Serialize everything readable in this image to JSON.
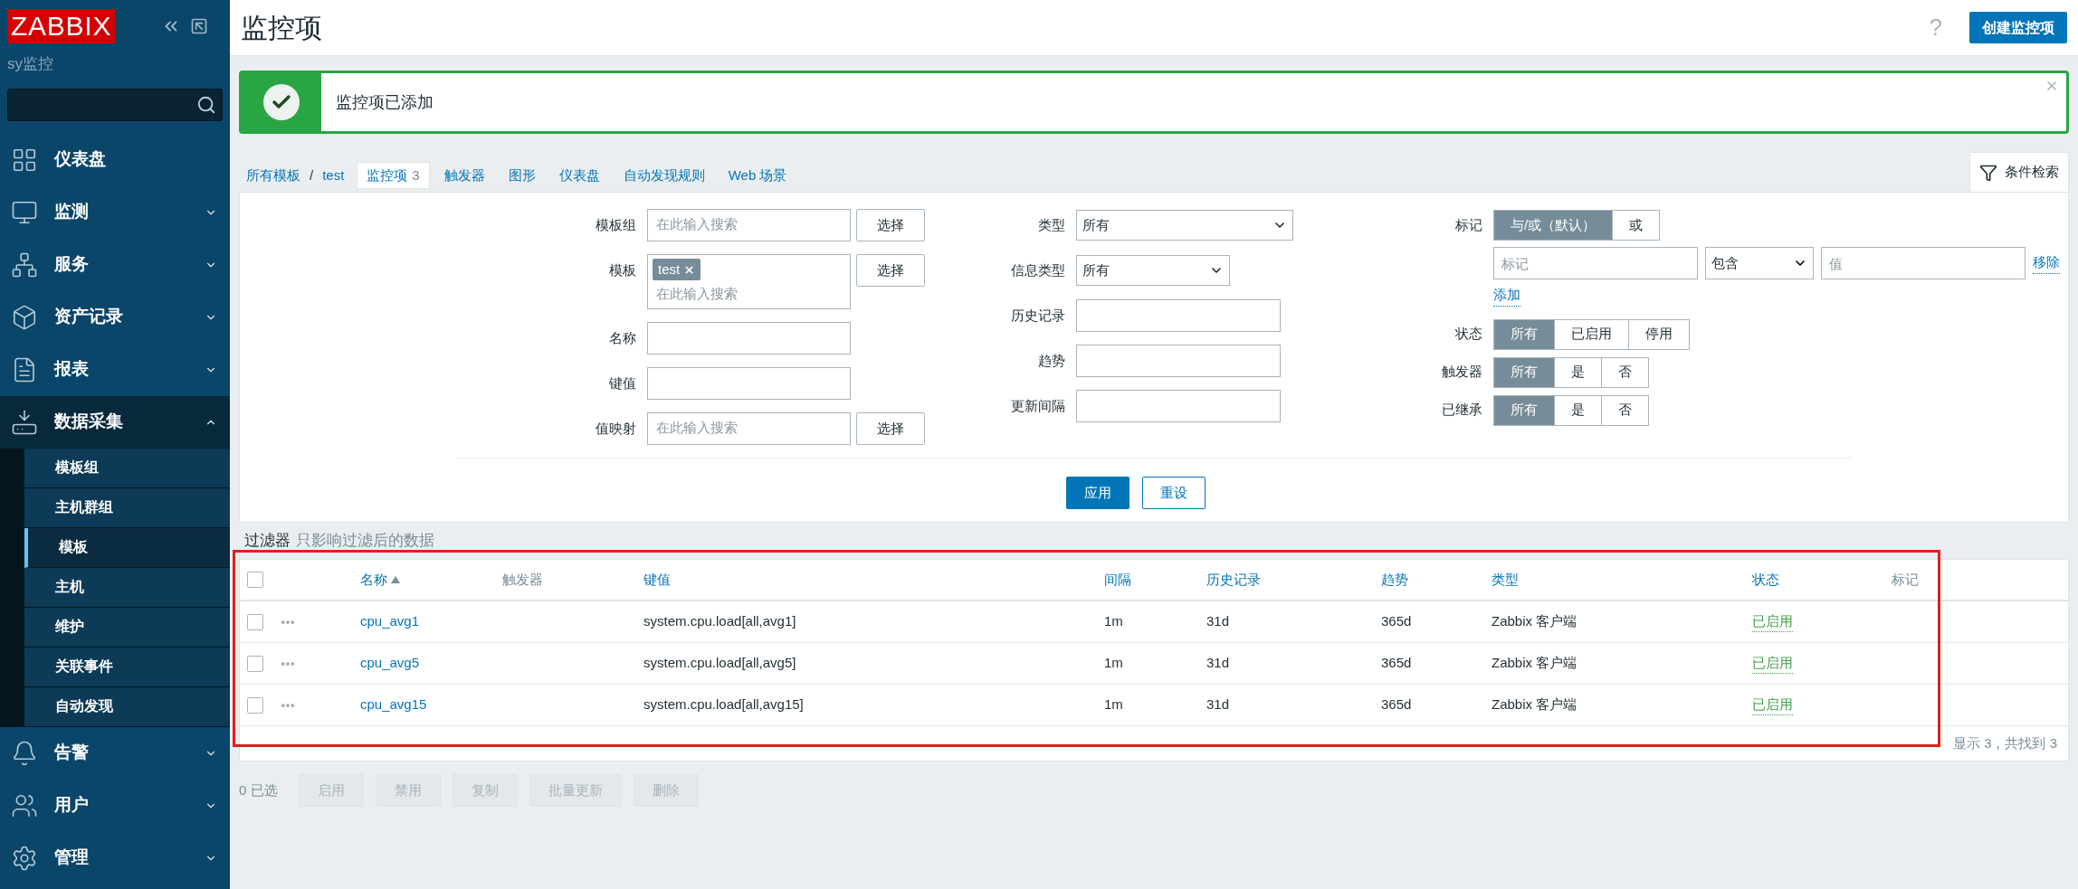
{
  "sidebar": {
    "logo": "ZABBIX",
    "instance": "sy监控",
    "menu": [
      {
        "label": "仪表盘",
        "kind": "dashboard",
        "expanded": false,
        "has_submenu": false
      },
      {
        "label": "监测",
        "kind": "monitoring",
        "expanded": false,
        "has_submenu": true
      },
      {
        "label": "服务",
        "kind": "services",
        "expanded": false,
        "has_submenu": true
      },
      {
        "label": "资产记录",
        "kind": "inventory",
        "expanded": false,
        "has_submenu": true
      },
      {
        "label": "报表",
        "kind": "reports",
        "expanded": false,
        "has_submenu": true
      },
      {
        "label": "数据采集",
        "kind": "datacollection",
        "expanded": true,
        "has_submenu": true,
        "children": [
          {
            "label": "模板组",
            "selected": false
          },
          {
            "label": "主机群组",
            "selected": false
          },
          {
            "label": "模板",
            "selected": true
          },
          {
            "label": "主机",
            "selected": false
          },
          {
            "label": "维护",
            "selected": false
          },
          {
            "label": "关联事件",
            "selected": false
          },
          {
            "label": "自动发现",
            "selected": false
          }
        ]
      },
      {
        "label": "告警",
        "kind": "alerts",
        "expanded": false,
        "has_submenu": true
      },
      {
        "label": "用户",
        "kind": "users",
        "expanded": false,
        "has_submenu": true
      },
      {
        "label": "管理",
        "kind": "admin",
        "expanded": false,
        "has_submenu": true
      }
    ]
  },
  "header": {
    "title": "监控项",
    "help": "?",
    "create_button": "创建监控项"
  },
  "message": {
    "kind": "success",
    "text": "监控项已添加"
  },
  "breadcrumbs": [
    {
      "label": "所有模板"
    },
    {
      "label": "test"
    }
  ],
  "breadcrumb_separator": "/",
  "nav_tabs": [
    {
      "label": "监控项",
      "count": "3",
      "selected": true
    },
    {
      "label": "触发器",
      "selected": false
    },
    {
      "label": "图形",
      "selected": false
    },
    {
      "label": "仪表盘",
      "selected": false
    },
    {
      "label": "自动发现规则",
      "selected": false
    },
    {
      "label": "Web 场景",
      "selected": false
    }
  ],
  "filter": {
    "tab_label": "条件检索",
    "expanded": true,
    "left": [
      {
        "kind": "multiselect",
        "label": "模板组",
        "placeholder": "在此输入搜索",
        "button": "选择"
      },
      {
        "kind": "multiselect",
        "label": "模板",
        "chips": [
          "test"
        ],
        "placeholder": "在此输入搜索",
        "button": "选择"
      },
      {
        "kind": "text",
        "label": "名称"
      },
      {
        "kind": "text",
        "label": "键值"
      },
      {
        "kind": "multiselect",
        "label": "值映射",
        "placeholder": "在此输入搜索",
        "button": "选择"
      }
    ],
    "middle": [
      {
        "kind": "select",
        "label": "类型",
        "value": "所有"
      },
      {
        "kind": "select",
        "label": "信息类型",
        "value": "所有"
      },
      {
        "kind": "text",
        "label": "历史记录"
      },
      {
        "kind": "text",
        "label": "趋势"
      },
      {
        "kind": "text",
        "label": "更新间隔"
      }
    ],
    "tags": {
      "label": "标记",
      "operators": [
        {
          "label": "与/或（默认）",
          "selected": true
        },
        {
          "label": "或",
          "selected": false
        }
      ],
      "rows": [
        {
          "tag_placeholder": "标记",
          "operator": "包含",
          "value_placeholder": "值",
          "remove": "移除"
        }
      ],
      "add": "添加"
    },
    "right": [
      {
        "label": "状态",
        "options": [
          {
            "label": "所有",
            "selected": true
          },
          {
            "label": "已启用",
            "selected": false
          },
          {
            "label": "停用",
            "selected": false
          }
        ]
      },
      {
        "label": "触发器",
        "options": [
          {
            "label": "所有",
            "selected": true
          },
          {
            "label": "是",
            "selected": false
          },
          {
            "label": "否",
            "selected": false
          }
        ]
      },
      {
        "label": "已继承",
        "options": [
          {
            "label": "所有",
            "selected": true
          },
          {
            "label": "是",
            "selected": false
          },
          {
            "label": "否",
            "selected": false
          }
        ]
      }
    ],
    "apply": "应用",
    "reset": "重设"
  },
  "filter_note": {
    "title": "过滤器",
    "text": "只影响过滤后的数据"
  },
  "table": {
    "highlighted": true,
    "all_checked": false,
    "columns": [
      {
        "label": "名称",
        "sortable": true,
        "sorted": true
      },
      {
        "label": "触发器",
        "sortable": false,
        "sorted": false
      },
      {
        "label": "键值",
        "sortable": true,
        "sorted": false
      },
      {
        "label": "间隔",
        "sortable": true,
        "sorted": false
      },
      {
        "label": "历史记录",
        "sortable": true,
        "sorted": false
      },
      {
        "label": "趋势",
        "sortable": true,
        "sorted": false
      },
      {
        "label": "类型",
        "sortable": true,
        "sorted": false
      },
      {
        "label": "状态",
        "sortable": true,
        "sorted": false
      },
      {
        "label": "标记",
        "sortable": false,
        "sorted": false
      }
    ],
    "rows": [
      {
        "checked": false,
        "name": "cpu_avg1",
        "key": "system.cpu.load[all,avg1]",
        "interval": "1m",
        "history": "31d",
        "trends": "365d",
        "type": "Zabbix 客户端",
        "status": {
          "label": "已启用",
          "kind": "enabled"
        }
      },
      {
        "checked": false,
        "name": "cpu_avg5",
        "key": "system.cpu.load[all,avg5]",
        "interval": "1m",
        "history": "31d",
        "trends": "365d",
        "type": "Zabbix 客户端",
        "status": {
          "label": "已启用",
          "kind": "enabled"
        }
      },
      {
        "checked": false,
        "name": "cpu_avg15",
        "key": "system.cpu.load[all,avg15]",
        "interval": "1m",
        "history": "31d",
        "trends": "365d",
        "type": "Zabbix 客户端",
        "status": {
          "label": "已启用",
          "kind": "enabled"
        }
      }
    ],
    "footer": "显示 3，共找到 3"
  },
  "actions": {
    "selected_count": "0 已选",
    "buttons": [
      {
        "label": "启用",
        "disabled": true
      },
      {
        "label": "禁用",
        "disabled": true
      },
      {
        "label": "复制",
        "disabled": true
      },
      {
        "label": "批量更新",
        "disabled": true
      },
      {
        "label": "删除",
        "disabled": true
      }
    ]
  }
}
